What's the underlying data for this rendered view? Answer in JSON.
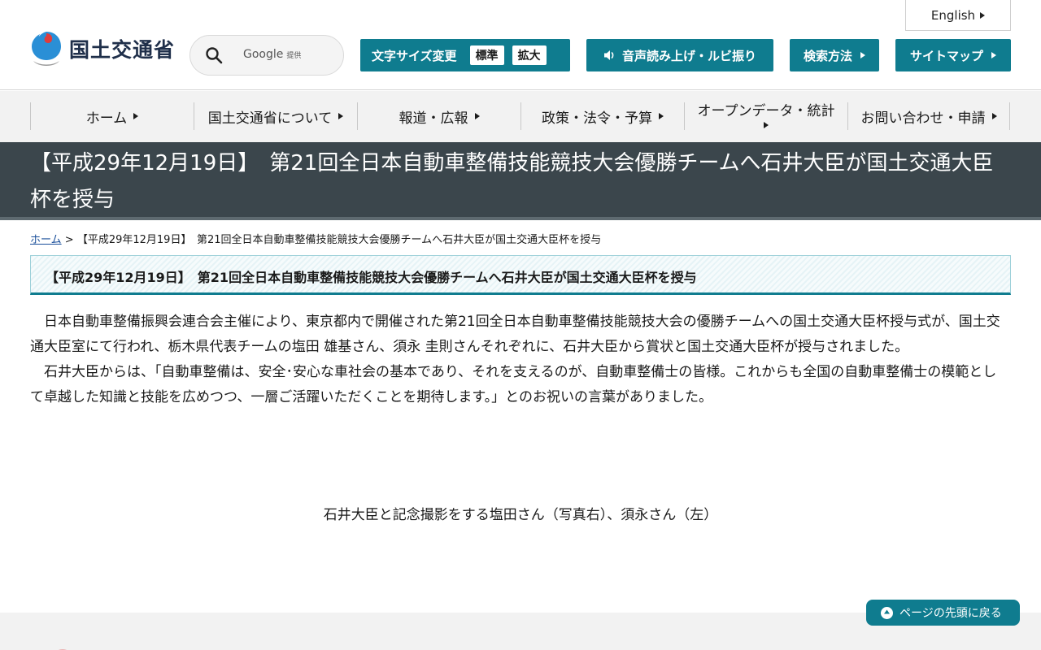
{
  "header": {
    "logo_text": "国土交通省",
    "search": {
      "brand": "Google",
      "brand_sub": "提供",
      "placeholder": ""
    },
    "english_label": "English",
    "font_size": {
      "label": "文字サイズ変更",
      "options": [
        "標準",
        "拡大"
      ]
    },
    "voice_label": "音声読み上げ・ルビ振り",
    "search_method_label": "検索方法",
    "sitemap_label": "サイトマップ"
  },
  "nav": {
    "items": [
      {
        "label": "ホーム"
      },
      {
        "label": "国土交通省について"
      },
      {
        "label": "報道・広報"
      },
      {
        "label": "政策・法令・予算"
      },
      {
        "label": "オープンデータ・統計"
      },
      {
        "label": "お問い合わせ・申請"
      }
    ]
  },
  "page": {
    "title": "【平成29年12月19日】　第21回全日本自動車整備技能競技大会優勝チームへ石井大臣が国土交通大臣杯を授与",
    "breadcrumb": {
      "home": "ホーム",
      "separator": ">",
      "current": "【平成29年12月19日】　第21回全日本自動車整備技能競技大会優勝チームへ石井大臣が国土交通大臣杯を授与"
    },
    "section_heading": "【平成29年12月19日】　第21回全日本自動車整備技能競技大会優勝チームへ石井大臣が国土交通大臣杯を授与",
    "paragraphs": [
      "日本自動車整備振興会連合会主催により、東京都内で開催された第21回全日本自動車整備技能競技大会の優勝チームへの国土交通大臣杯授与式が、国土交通大臣室にて行われ、栃木県代表チームの塩田 雄基さん、須永 圭則さんそれぞれに、石井大臣から賞状と国土交通大臣杯が授与されました。",
      "石井大臣からは、「自動車整備は、安全･安心な車社会の基本であり、それを支えるのが、自動車整備士の皆様。これからも全国の自動車整備士の模範として卓越した知識と技能を広めつつ、一層ご活躍いただくことを期待します。」とのお祝いの言葉がありました。"
    ],
    "photo_caption": "石井大臣と記念撮影をする塩田さん（写真右）、須永さん（左）"
  },
  "back_to_top_label": "ページの先頭に戻る",
  "colors": {
    "accent": "#0f7c8f",
    "title_band": "#3b464c",
    "nav_bg": "#f2f2f2",
    "link": "#1a4f9a"
  },
  "icons": {
    "logo": "mlit-logo-icon",
    "search": "search-icon",
    "speaker": "speaker-icon",
    "arrow": "triangle-right-icon",
    "to_top": "arrow-up-circle-icon"
  }
}
